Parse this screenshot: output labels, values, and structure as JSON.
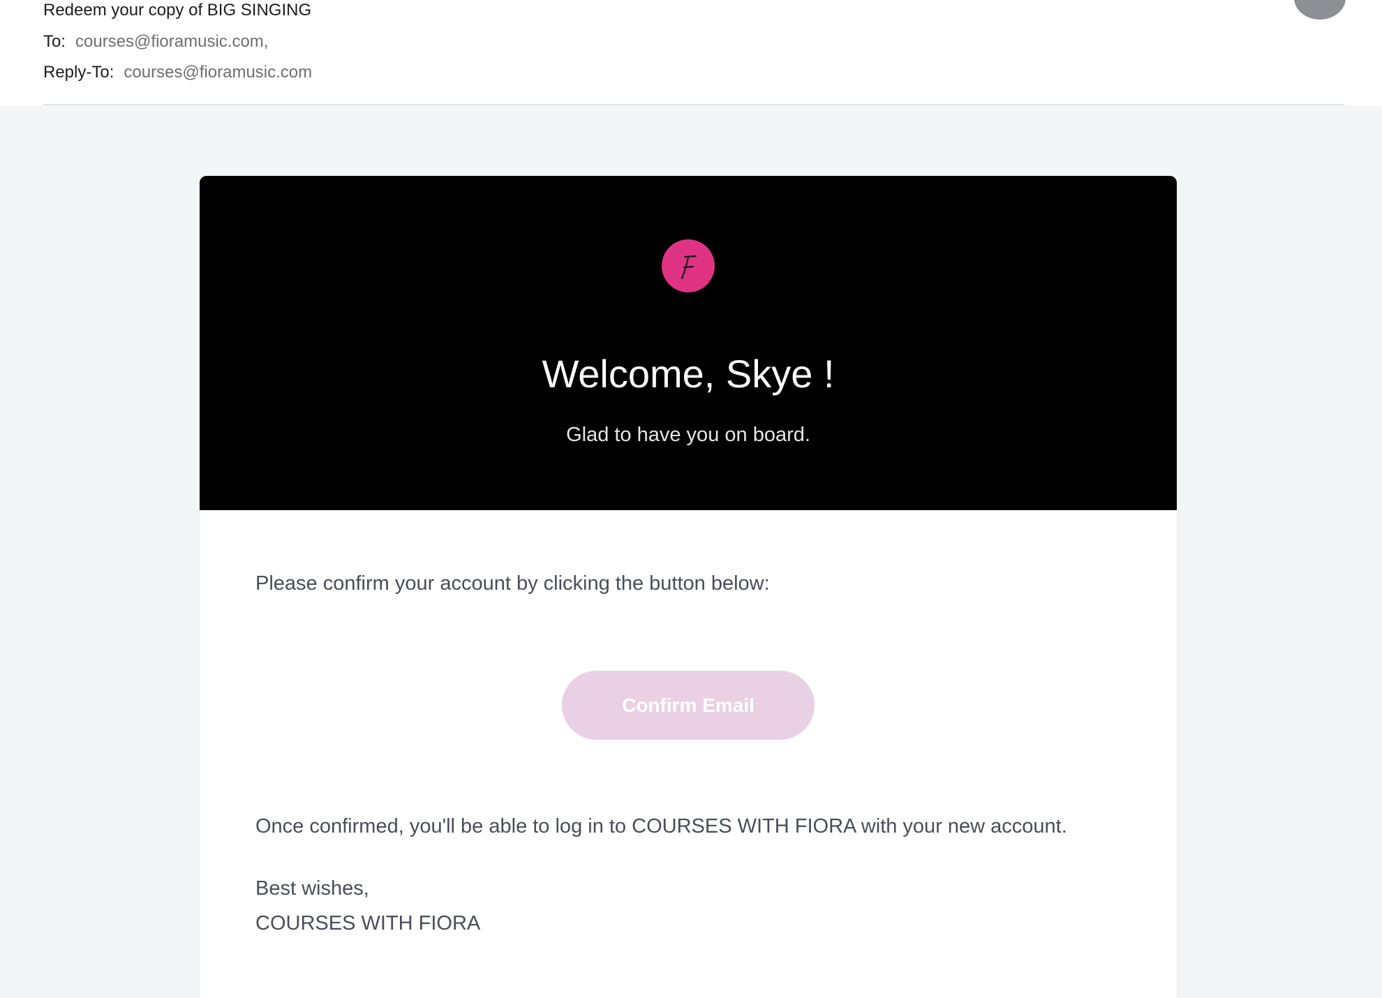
{
  "email": {
    "subject": "Redeem your copy of BIG SINGING",
    "to_label": "To:",
    "to_value": "courses@fioramusic.com,",
    "reply_to_label": "Reply-To:",
    "reply_to_value": "courses@fioramusic.com"
  },
  "message": {
    "logo_letter": "F",
    "logo_color": "#e03383",
    "welcome": "Welcome, Skye !",
    "tagline": "Glad to have you on board.",
    "confirm_prompt": "Please confirm your account by clicking the button below:",
    "confirm_button": "Confirm Email",
    "confirm_button_color": "#ead0e5",
    "once_confirmed": "Once confirmed, you'll be able to log in to COURSES WITH FIORA with your new account.",
    "signoff": "Best wishes,",
    "signature": "COURSES WITH FIORA"
  }
}
